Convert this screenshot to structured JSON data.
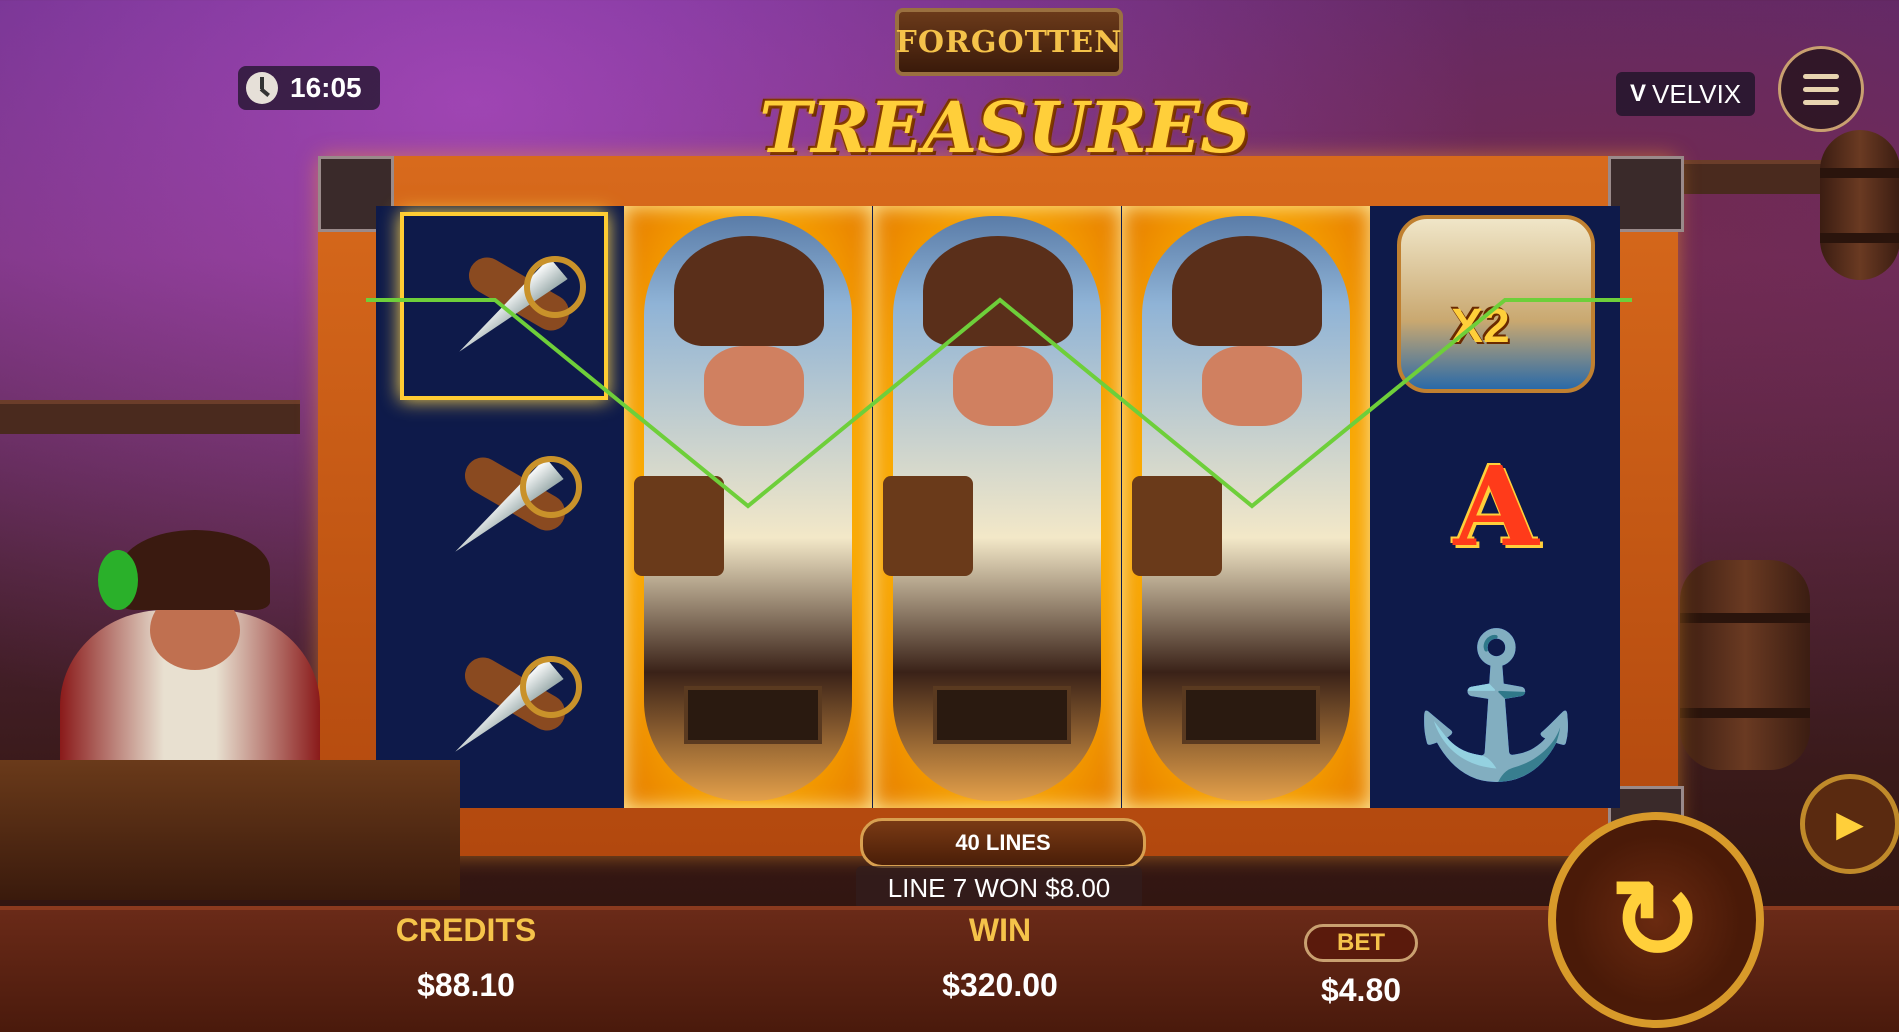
{
  "clock": {
    "time": "16:05"
  },
  "brand": {
    "name": "VELVIX",
    "logo_glyph": "V"
  },
  "menu": {
    "icon": "hamburger-icon"
  },
  "title": {
    "top": "FORGOTTEN",
    "bottom": "TREASURES"
  },
  "reels": {
    "reel1": [
      "sword-symbol",
      "sword-symbol",
      "sword-symbol"
    ],
    "reel2": [
      "pirate-wild-expanded"
    ],
    "reel3": [
      "pirate-wild-expanded"
    ],
    "reel4": [
      "pirate-wild-expanded"
    ],
    "reel5": [
      "ship-multiplier-symbol",
      "A",
      "anchor-symbol"
    ],
    "multiplier": "X2",
    "letter": "A",
    "anchor_glyph": "⚓"
  },
  "lines": {
    "label": "40 LINES"
  },
  "win_message": "LINE 7 WON $8.00",
  "stats": {
    "credits_label": "CREDITS",
    "credits_value": "$88.10",
    "win_label": "WIN",
    "win_value": "$320.00",
    "bet_label": "BET",
    "bet_value": "$4.80"
  },
  "buttons": {
    "spin_glyph": "↻",
    "autoplay_glyph": "▶"
  },
  "colors": {
    "payline": "#6ecf3a",
    "gold": "#f5c34a",
    "frame": "#d86a1c"
  }
}
